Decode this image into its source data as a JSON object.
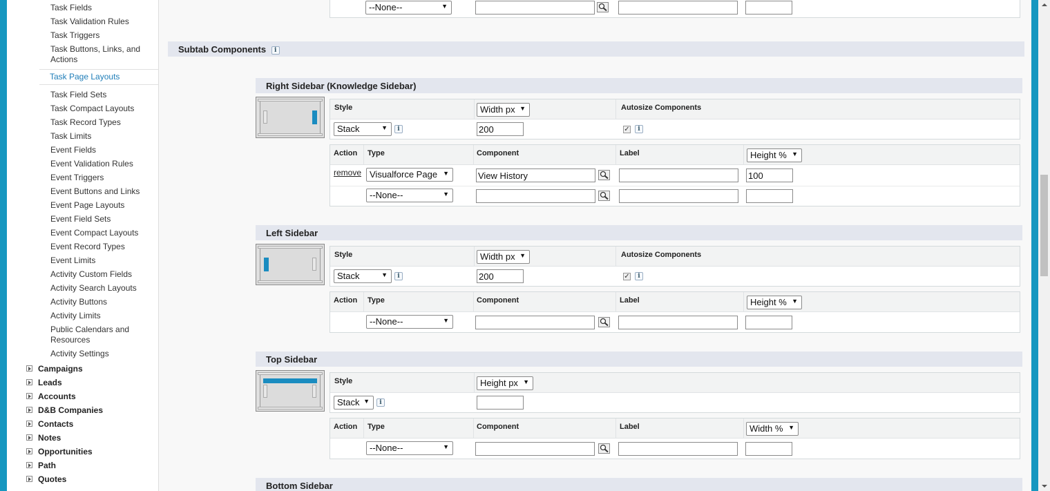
{
  "sidebar": {
    "setup_items": [
      {
        "label": "Task Fields"
      },
      {
        "label": "Task Validation Rules"
      },
      {
        "label": "Task Triggers"
      },
      {
        "label": "Task Buttons, Links, and Actions"
      },
      {
        "label": "Task Page Layouts",
        "selected": true
      },
      {
        "label": "Task Field Sets"
      },
      {
        "label": "Task Compact Layouts"
      },
      {
        "label": "Task Record Types"
      },
      {
        "label": "Task Limits"
      },
      {
        "label": "Event Fields"
      },
      {
        "label": "Event Validation Rules"
      },
      {
        "label": "Event Triggers"
      },
      {
        "label": "Event Buttons and Links"
      },
      {
        "label": "Event Page Layouts"
      },
      {
        "label": "Event Field Sets"
      },
      {
        "label": "Event Compact Layouts"
      },
      {
        "label": "Event Record Types"
      },
      {
        "label": "Event Limits"
      },
      {
        "label": "Activity Custom Fields"
      },
      {
        "label": "Activity Search Layouts"
      },
      {
        "label": "Activity Buttons"
      },
      {
        "label": "Activity Limits"
      },
      {
        "label": "Public Calendars and Resources"
      },
      {
        "label": "Activity Settings"
      }
    ],
    "top_items": [
      {
        "label": "Campaigns"
      },
      {
        "label": "Leads"
      },
      {
        "label": "Accounts"
      },
      {
        "label": "D&B Companies"
      },
      {
        "label": "Contacts"
      },
      {
        "label": "Notes"
      },
      {
        "label": "Opportunities"
      },
      {
        "label": "Path"
      },
      {
        "label": "Quotes"
      }
    ]
  },
  "top_row": {
    "type_value": "--None--"
  },
  "subtab_section": {
    "title": "Subtab Components",
    "info_icon": "i"
  },
  "right_sidebar": {
    "title": "Right Sidebar (Knowledge Sidebar)",
    "style_label": "Style",
    "size_select": "Width px",
    "autosize_label": "Autosize Components",
    "style_value": "Stack",
    "size_value": "200",
    "autosize_checked": true,
    "headers": {
      "action": "Action",
      "type": "Type",
      "component": "Component",
      "label": "Label",
      "dim": "Height %"
    },
    "rows": [
      {
        "action": "remove",
        "type": "Visualforce Page",
        "component": "View History",
        "label": "",
        "dim": "100"
      },
      {
        "action": "",
        "type": "--None--",
        "component": "",
        "label": "",
        "dim": ""
      }
    ]
  },
  "left_sidebar": {
    "title": "Left Sidebar",
    "style_label": "Style",
    "size_select": "Width px",
    "autosize_label": "Autosize Components",
    "style_value": "Stack",
    "size_value": "200",
    "autosize_checked": true,
    "headers": {
      "action": "Action",
      "type": "Type",
      "component": "Component",
      "label": "Label",
      "dim": "Height %"
    },
    "rows": [
      {
        "action": "",
        "type": "--None--",
        "component": "",
        "label": "",
        "dim": ""
      }
    ]
  },
  "top_sidebar": {
    "title": "Top Sidebar",
    "style_label": "Style",
    "size_select": "Height px",
    "style_value": "Stack",
    "size_value": "",
    "headers": {
      "action": "Action",
      "type": "Type",
      "component": "Component",
      "label": "Label",
      "dim": "Width %"
    },
    "rows": [
      {
        "action": "",
        "type": "--None--",
        "component": "",
        "label": "",
        "dim": ""
      }
    ]
  },
  "bottom_sidebar": {
    "title": "Bottom Sidebar"
  },
  "colors": {
    "accent": "#1797c0",
    "header_bg": "#e3e6ee",
    "selected_text": "#1e7db8",
    "thumb_highlight": "#1a8cc0"
  },
  "icons": {
    "lookup": "magnifier-lookup-icon",
    "info": "info-icon",
    "expand": "expand-arrow-icon"
  }
}
